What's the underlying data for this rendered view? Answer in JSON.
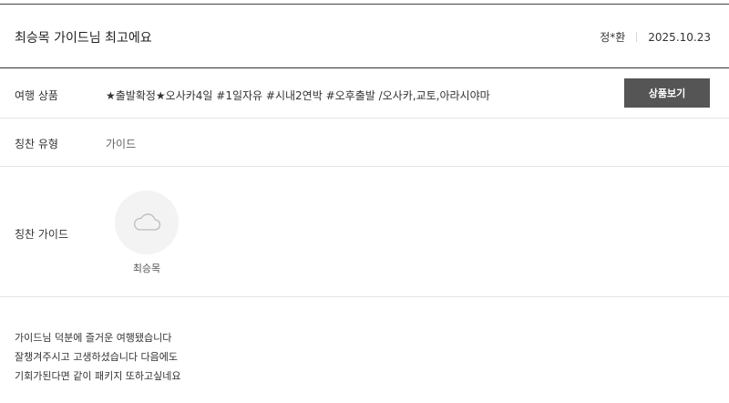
{
  "review": {
    "title": "최승목 가이드님 최고에요",
    "author": "정*환",
    "date": "2025.10.23"
  },
  "product": {
    "label": "여행 상품",
    "value": "★출발확정★오사카4일 #1일자유 #시내2연박 #오후출발 /오사카,교토,아라시야마",
    "button_label": "상품보기"
  },
  "praise_type": {
    "label": "칭찬 유형",
    "value": "가이드"
  },
  "praise_guide": {
    "label": "칭찬 가이드",
    "name": "최승목",
    "avatar_icon": "cloud-placeholder-icon"
  },
  "body": {
    "lines": [
      "가이드님 덕분에 즐거운 여행됐습니다",
      "잘챙겨주시고 고생하셨습니다 다음에도",
      "기회가된다면 같이 패키지 또하고싶네요"
    ]
  },
  "colors": {
    "button_bg": "#555555",
    "avatar_bg": "#f3f3f3",
    "divider": "#e4e4e4"
  }
}
